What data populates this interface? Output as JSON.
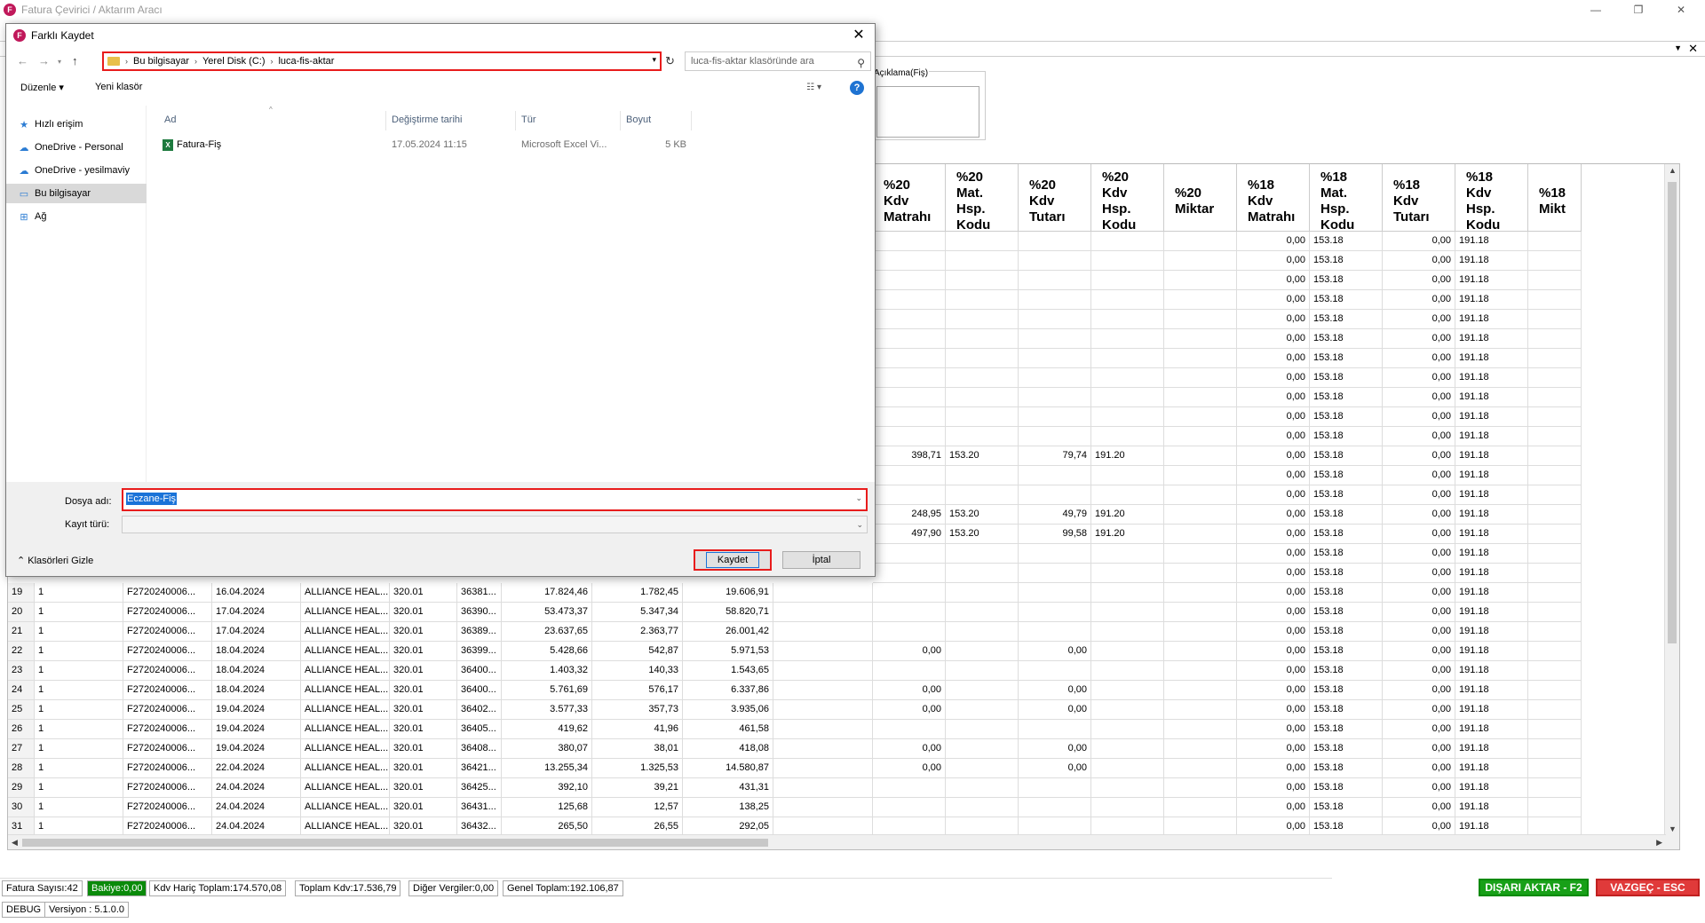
{
  "app": {
    "logo_letter": "F",
    "title": "Fatura Çevirici / Aktarım Aracı",
    "minimize": "—",
    "maximize": "❐",
    "close": "✕",
    "menubar_arrow": "▼",
    "menubar_close": "✕",
    "aciklama_label": "Açıklama(Fiş)"
  },
  "grid": {
    "headers": [
      "%20 Kdv Matrahı",
      "%20 Mat. Hsp. Kodu",
      "%20 Kdv Tutarı",
      "%20 Kdv Hsp. Kodu",
      "%20 Miktar",
      "%18 Kdv Matrahı",
      "%18 Mat. Hsp. Kodu",
      "%18 Kdv Tutarı",
      "%18 Kdv Hsp. Kodu",
      "%18 Mikt"
    ],
    "upper_rows": [
      {
        "c20m": "",
        "c20h": "",
        "c20t": "",
        "c20k": "",
        "c18m": "0,00",
        "c18h": "153.18",
        "c18t": "0,00",
        "c18k": "191.18"
      },
      {
        "c20m": "",
        "c20h": "",
        "c20t": "",
        "c20k": "",
        "c18m": "0,00",
        "c18h": "153.18",
        "c18t": "0,00",
        "c18k": "191.18"
      },
      {
        "c20m": "",
        "c20h": "",
        "c20t": "",
        "c20k": "",
        "c18m": "0,00",
        "c18h": "153.18",
        "c18t": "0,00",
        "c18k": "191.18"
      },
      {
        "c20m": "",
        "c20h": "",
        "c20t": "",
        "c20k": "",
        "c18m": "0,00",
        "c18h": "153.18",
        "c18t": "0,00",
        "c18k": "191.18"
      },
      {
        "c20m": "",
        "c20h": "",
        "c20t": "",
        "c20k": "",
        "c18m": "0,00",
        "c18h": "153.18",
        "c18t": "0,00",
        "c18k": "191.18"
      },
      {
        "c20m": "",
        "c20h": "",
        "c20t": "",
        "c20k": "",
        "c18m": "0,00",
        "c18h": "153.18",
        "c18t": "0,00",
        "c18k": "191.18"
      },
      {
        "c20m": "",
        "c20h": "",
        "c20t": "",
        "c20k": "",
        "c18m": "0,00",
        "c18h": "153.18",
        "c18t": "0,00",
        "c18k": "191.18"
      },
      {
        "c20m": "",
        "c20h": "",
        "c20t": "",
        "c20k": "",
        "c18m": "0,00",
        "c18h": "153.18",
        "c18t": "0,00",
        "c18k": "191.18"
      },
      {
        "c20m": "",
        "c20h": "",
        "c20t": "",
        "c20k": "",
        "c18m": "0,00",
        "c18h": "153.18",
        "c18t": "0,00",
        "c18k": "191.18"
      },
      {
        "c20m": "",
        "c20h": "",
        "c20t": "",
        "c20k": "",
        "c18m": "0,00",
        "c18h": "153.18",
        "c18t": "0,00",
        "c18k": "191.18"
      },
      {
        "c20m": "",
        "c20h": "",
        "c20t": "",
        "c20k": "",
        "c18m": "0,00",
        "c18h": "153.18",
        "c18t": "0,00",
        "c18k": "191.18"
      },
      {
        "c20m": "398,71",
        "c20h": "153.20",
        "c20t": "79,74",
        "c20k": "191.20",
        "c18m": "0,00",
        "c18h": "153.18",
        "c18t": "0,00",
        "c18k": "191.18"
      },
      {
        "c20m": "",
        "c20h": "",
        "c20t": "",
        "c20k": "",
        "c18m": "0,00",
        "c18h": "153.18",
        "c18t": "0,00",
        "c18k": "191.18"
      },
      {
        "c20m": "",
        "c20h": "",
        "c20t": "",
        "c20k": "",
        "c18m": "0,00",
        "c18h": "153.18",
        "c18t": "0,00",
        "c18k": "191.18"
      },
      {
        "c20m": "248,95",
        "c20h": "153.20",
        "c20t": "49,79",
        "c20k": "191.20",
        "c18m": "0,00",
        "c18h": "153.18",
        "c18t": "0,00",
        "c18k": "191.18"
      },
      {
        "c20m": "497,90",
        "c20h": "153.20",
        "c20t": "99,58",
        "c20k": "191.20",
        "c18m": "0,00",
        "c18h": "153.18",
        "c18t": "0,00",
        "c18k": "191.18"
      },
      {
        "c20m": "",
        "c20h": "",
        "c20t": "",
        "c20k": "",
        "c18m": "0,00",
        "c18h": "153.18",
        "c18t": "0,00",
        "c18k": "191.18"
      },
      {
        "c20m": "",
        "c20h": "",
        "c20t": "",
        "c20k": "",
        "c18m": "0,00",
        "c18h": "153.18",
        "c18t": "0,00",
        "c18k": "191.18"
      }
    ],
    "lower_rows": [
      {
        "no": "19",
        "a": "1",
        "fat": "F2720240006...",
        "tarih": "16.04.2024",
        "firma": "ALLIANCE HEAL...",
        "hsp": "320.01",
        "kod": "36381...",
        "mat": "17.824,46",
        "kdv": "1.782,45",
        "top": "19.606,91",
        "c20m": "",
        "c20t": "",
        "c18m": "0,00",
        "c18h": "153.18",
        "c18t": "0,00",
        "c18k": "191.18"
      },
      {
        "no": "20",
        "a": "1",
        "fat": "F2720240006...",
        "tarih": "17.04.2024",
        "firma": "ALLIANCE HEAL...",
        "hsp": "320.01",
        "kod": "36390...",
        "mat": "53.473,37",
        "kdv": "5.347,34",
        "top": "58.820,71",
        "c20m": "",
        "c20t": "",
        "c18m": "0,00",
        "c18h": "153.18",
        "c18t": "0,00",
        "c18k": "191.18"
      },
      {
        "no": "21",
        "a": "1",
        "fat": "F2720240006...",
        "tarih": "17.04.2024",
        "firma": "ALLIANCE HEAL...",
        "hsp": "320.01",
        "kod": "36389...",
        "mat": "23.637,65",
        "kdv": "2.363,77",
        "top": "26.001,42",
        "c20m": "",
        "c20t": "",
        "c18m": "0,00",
        "c18h": "153.18",
        "c18t": "0,00",
        "c18k": "191.18"
      },
      {
        "no": "22",
        "a": "1",
        "fat": "F2720240006...",
        "tarih": "18.04.2024",
        "firma": "ALLIANCE HEAL...",
        "hsp": "320.01",
        "kod": "36399...",
        "mat": "5.428,66",
        "kdv": "542,87",
        "top": "5.971,53",
        "c20m": "0,00",
        "c20t": "0,00",
        "c18m": "0,00",
        "c18h": "153.18",
        "c18t": "0,00",
        "c18k": "191.18"
      },
      {
        "no": "23",
        "a": "1",
        "fat": "F2720240006...",
        "tarih": "18.04.2024",
        "firma": "ALLIANCE HEAL...",
        "hsp": "320.01",
        "kod": "36400...",
        "mat": "1.403,32",
        "kdv": "140,33",
        "top": "1.543,65",
        "c20m": "",
        "c20t": "",
        "c18m": "0,00",
        "c18h": "153.18",
        "c18t": "0,00",
        "c18k": "191.18"
      },
      {
        "no": "24",
        "a": "1",
        "fat": "F2720240006...",
        "tarih": "18.04.2024",
        "firma": "ALLIANCE HEAL...",
        "hsp": "320.01",
        "kod": "36400...",
        "mat": "5.761,69",
        "kdv": "576,17",
        "top": "6.337,86",
        "c20m": "0,00",
        "c20t": "0,00",
        "c18m": "0,00",
        "c18h": "153.18",
        "c18t": "0,00",
        "c18k": "191.18"
      },
      {
        "no": "25",
        "a": "1",
        "fat": "F2720240006...",
        "tarih": "19.04.2024",
        "firma": "ALLIANCE HEAL...",
        "hsp": "320.01",
        "kod": "36402...",
        "mat": "3.577,33",
        "kdv": "357,73",
        "top": "3.935,06",
        "c20m": "0,00",
        "c20t": "0,00",
        "c18m": "0,00",
        "c18h": "153.18",
        "c18t": "0,00",
        "c18k": "191.18"
      },
      {
        "no": "26",
        "a": "1",
        "fat": "F2720240006...",
        "tarih": "19.04.2024",
        "firma": "ALLIANCE HEAL...",
        "hsp": "320.01",
        "kod": "36405...",
        "mat": "419,62",
        "kdv": "41,96",
        "top": "461,58",
        "c20m": "",
        "c20t": "",
        "c18m": "0,00",
        "c18h": "153.18",
        "c18t": "0,00",
        "c18k": "191.18"
      },
      {
        "no": "27",
        "a": "1",
        "fat": "F2720240006...",
        "tarih": "19.04.2024",
        "firma": "ALLIANCE HEAL...",
        "hsp": "320.01",
        "kod": "36408...",
        "mat": "380,07",
        "kdv": "38,01",
        "top": "418,08",
        "c20m": "0,00",
        "c20t": "0,00",
        "c18m": "0,00",
        "c18h": "153.18",
        "c18t": "0,00",
        "c18k": "191.18"
      },
      {
        "no": "28",
        "a": "1",
        "fat": "F2720240006...",
        "tarih": "22.04.2024",
        "firma": "ALLIANCE HEAL...",
        "hsp": "320.01",
        "kod": "36421...",
        "mat": "13.255,34",
        "kdv": "1.325,53",
        "top": "14.580,87",
        "c20m": "0,00",
        "c20t": "0,00",
        "c18m": "0,00",
        "c18h": "153.18",
        "c18t": "0,00",
        "c18k": "191.18"
      },
      {
        "no": "29",
        "a": "1",
        "fat": "F2720240006...",
        "tarih": "24.04.2024",
        "firma": "ALLIANCE HEAL...",
        "hsp": "320.01",
        "kod": "36425...",
        "mat": "392,10",
        "kdv": "39,21",
        "top": "431,31",
        "c20m": "",
        "c20t": "",
        "c18m": "0,00",
        "c18h": "153.18",
        "c18t": "0,00",
        "c18k": "191.18"
      },
      {
        "no": "30",
        "a": "1",
        "fat": "F2720240006...",
        "tarih": "24.04.2024",
        "firma": "ALLIANCE HEAL...",
        "hsp": "320.01",
        "kod": "36431...",
        "mat": "125,68",
        "kdv": "12,57",
        "top": "138,25",
        "c20m": "",
        "c20t": "",
        "c18m": "0,00",
        "c18h": "153.18",
        "c18t": "0,00",
        "c18k": "191.18"
      },
      {
        "no": "31",
        "a": "1",
        "fat": "F2720240006...",
        "tarih": "24.04.2024",
        "firma": "ALLIANCE HEAL...",
        "hsp": "320.01",
        "kod": "36432...",
        "mat": "265,50",
        "kdv": "26,55",
        "top": "292,05",
        "c20m": "",
        "c20t": "",
        "c18m": "0,00",
        "c18h": "153.18",
        "c18t": "0,00",
        "c18k": "191.18"
      }
    ]
  },
  "footer": {
    "fatura_sayisi": "Fatura Sayısı:42",
    "bakiye": "Bakiye:0,00",
    "kdv_haric": "Kdv Hariç Toplam:174.570,08",
    "toplam_kdv": "Toplam Kdv:17.536,79",
    "diger": "Diğer Vergiler:0,00",
    "genel": "Genel Toplam:192.106,87",
    "disari_aktar": "DIŞARI AKTAR - F2",
    "vazgec": "VAZGEÇ - ESC",
    "debug": "DEBUG",
    "version": "Versiyon : 5.1.0.0"
  },
  "dialog": {
    "logo_letter": "F",
    "title": "Farklı Kaydet",
    "close": "✕",
    "breadcrumbs": [
      "Bu bilgisayar",
      "Yerel Disk (C:)",
      "luca-fis-aktar"
    ],
    "search_placeholder": "luca-fis-aktar klasöründe ara",
    "organize": "Düzenle ▾",
    "new_folder": "Yeni klasör",
    "help": "?",
    "sidebar": [
      {
        "label": "Hızlı erişim",
        "icon": "★"
      },
      {
        "label": "OneDrive - Personal",
        "icon": "☁"
      },
      {
        "label": "OneDrive - yesilmaviy",
        "icon": "☁"
      },
      {
        "label": "Bu bilgisayar",
        "icon": "▭"
      },
      {
        "label": "Ağ",
        "icon": "⊞"
      }
    ],
    "columns": [
      "Ad",
      "Değiştirme tarihi",
      "Tür",
      "Boyut"
    ],
    "file": {
      "name": "Fatura-Fiş",
      "date": "17.05.2024 11:15",
      "type": "Microsoft Excel Vi...",
      "size": "5 KB",
      "icon_letter": "X"
    },
    "filename_label": "Dosya adı:",
    "filename_value": "Eczane-Fiş",
    "type_label": "Kayıt türü:",
    "type_value": "",
    "hide_folders": "Klasörleri Gizle",
    "save": "Kaydet",
    "cancel": "İptal"
  },
  "colors": {
    "accent_red": "#e81c1c",
    "aktar_green": "#18a018",
    "vazgec_red": "#e03a3a",
    "select_blue": "#1a73d8"
  }
}
